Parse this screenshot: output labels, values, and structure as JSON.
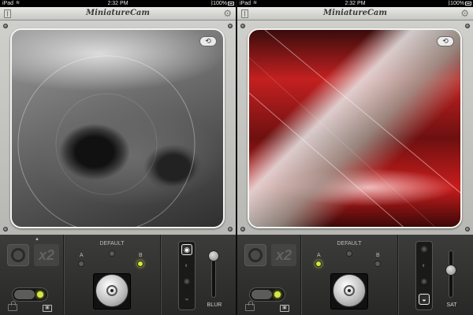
{
  "status_bar": {
    "device": "iPad",
    "time": "2:32 PM",
    "battery": "100%"
  },
  "app_title": "MiniatureCam",
  "panels": [
    {
      "photo_subject": "car-headlight",
      "controls": {
        "x2_label": "x2",
        "default_label": "DEFAULT",
        "a_label": "A",
        "b_label": "B",
        "selected_preset": "B",
        "mode_icons": [
          "focus-ring-icon",
          "half-circle-icon",
          "sun-icon",
          "contrast-icon"
        ],
        "active_mode_index": 0,
        "slider_label": "BLUR",
        "slider_level": 0.15
      }
    },
    {
      "photo_subject": "red-bridge",
      "controls": {
        "x2_label": "x2",
        "default_label": "DEFAULT",
        "a_label": "A",
        "b_label": "B",
        "selected_preset": "A",
        "mode_icons": [
          "focus-ring-icon",
          "half-circle-icon",
          "sun-icon",
          "contrast-icon"
        ],
        "active_mode_index": 3,
        "slider_label": "SAT",
        "slider_level": 0.45
      }
    }
  ],
  "icons": {
    "wifi": "wifi-icon",
    "bluetooth": "bluetooth-icon",
    "gear": "⚙",
    "camera_switch": "⟲"
  },
  "colors": {
    "indicator_green": "#d5e840",
    "titlebar": "#d8d8d4",
    "control_panel": "#2f2f2d"
  }
}
